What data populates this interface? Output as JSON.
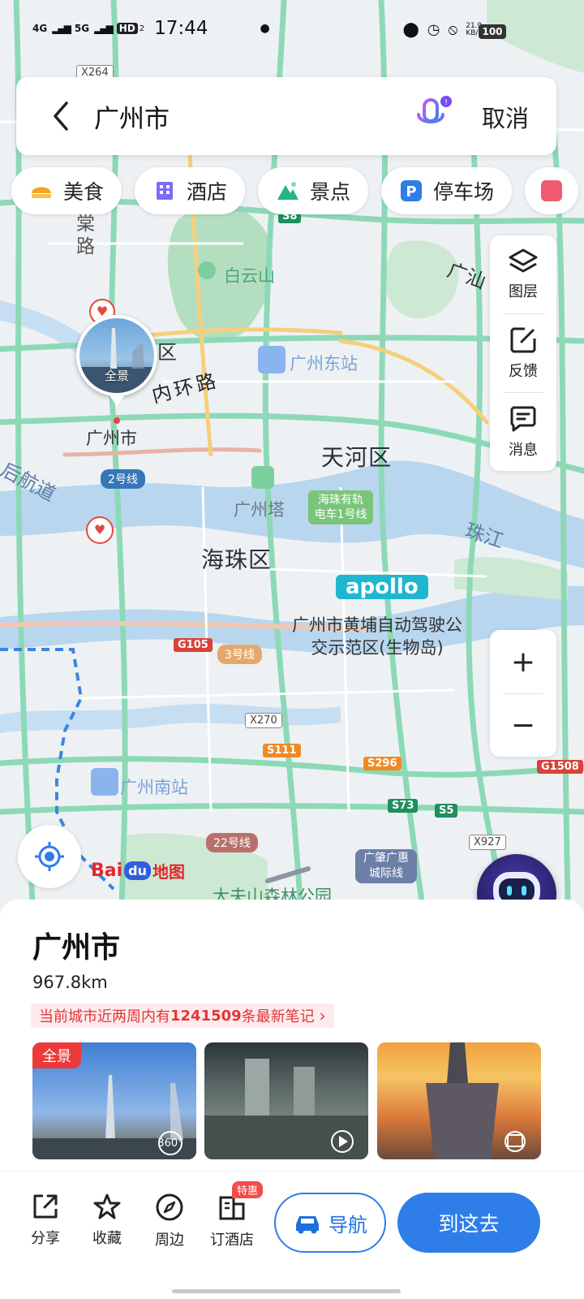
{
  "status_bar": {
    "signal_1": "4G",
    "signal_2": "5G",
    "hd": "HD",
    "hd_sub": "2",
    "time": "17:44",
    "net_speed_value": "21.9",
    "net_speed_unit": "KB/s",
    "battery": "100"
  },
  "search": {
    "query": "广州市",
    "cancel_label": "取消"
  },
  "chips": [
    {
      "label": "美食",
      "icon": "food-icon",
      "color": "#f4a623"
    },
    {
      "label": "酒店",
      "icon": "hotel-icon",
      "color": "#7b6cf6"
    },
    {
      "label": "景点",
      "icon": "scenic-icon",
      "color": "#25b38a"
    },
    {
      "label": "停车场",
      "icon": "parking-icon",
      "color": "#2f7de8"
    }
  ],
  "map_tools": {
    "layers_label": "图层",
    "feedback_label": "反馈",
    "messages_label": "消息"
  },
  "zoom": {
    "in": "+",
    "out": "−"
  },
  "map": {
    "labels": {
      "baiyun_mountain": "白云山",
      "guangzhou_east_station": "广州东站",
      "tianhe": "天河区",
      "guangzhou_tower": "广州塔",
      "haizhu": "海珠区",
      "haizhu_tram": "海珠有轨电车1号线",
      "guangzhou_city": "广州市",
      "huangpu_demo": "广州市黄埔自动驾驶公交示范区(生物岛)",
      "guangzhou_south": "广州南站",
      "inner_ring": "内环路",
      "pearl_river": "珠江",
      "guangshan": "广汕",
      "district_fragment": "区",
      "tang_road": "棠路",
      "hou_hang_road": "后航道",
      "line_2": "2号线",
      "line_3": "3号线",
      "line_22": "22号线",
      "guangzhao_line": "广肇广惠城际线",
      "forest_park": "大夫山森林公园",
      "apollo": "apollo",
      "pano_pin": "全景"
    },
    "shields": {
      "x264": "X264",
      "s8": "S8",
      "g105": "G105",
      "x270": "X270",
      "s111": "S111",
      "s296": "S296",
      "s73": "S73",
      "s5": "S5",
      "x927": "X927",
      "g1508": "G1508"
    },
    "logo_text": "地图"
  },
  "place": {
    "name": "广州市",
    "distance": "967.8km",
    "notes_banner_prefix": "当前城市近两周内有",
    "notes_count": "1241509",
    "notes_banner_suffix": "条最新笔记",
    "pano_tag": "全景"
  },
  "toolbar": {
    "share": "分享",
    "favorite": "收藏",
    "nearby": "周边",
    "book_hotel": "订酒店",
    "promo_badge": "特惠",
    "navigate": "导航",
    "go_here": "到这去"
  }
}
